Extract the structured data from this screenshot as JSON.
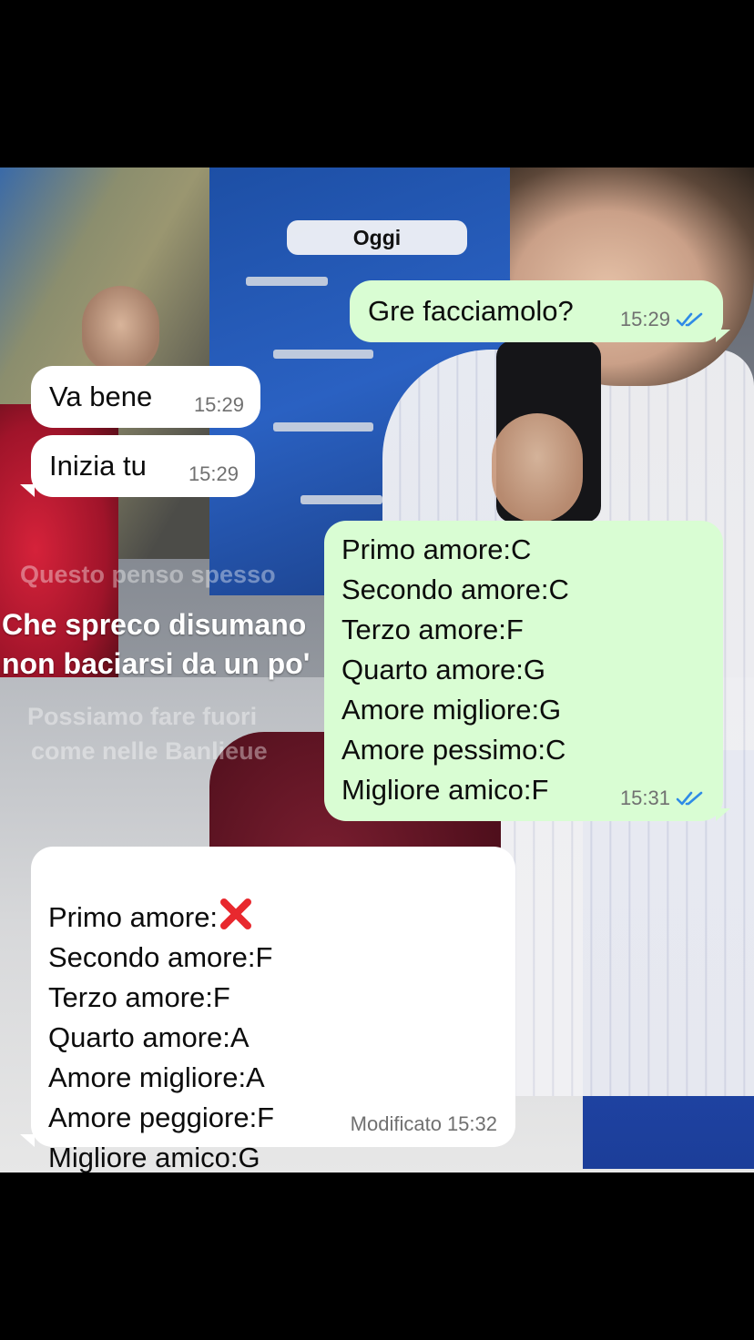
{
  "chat": {
    "date_label": "Oggi",
    "messages": [
      {
        "dir": "out",
        "text": "Gre facciamolo?",
        "time": "15:29",
        "status": "read"
      },
      {
        "dir": "in",
        "text": "Va bene",
        "time": "15:29"
      },
      {
        "dir": "in",
        "text": "Inizia tu",
        "time": "15:29"
      },
      {
        "dir": "out",
        "lines": [
          "Primo amore:C",
          "Secondo amore:C",
          "Terzo amore:F",
          "Quarto amore:G",
          "Amore migliore:G",
          "Amore pessimo:C",
          "Migliore amico:F"
        ],
        "time": "15:31",
        "status": "read"
      },
      {
        "dir": "in",
        "first_line_label": "Primo amore:",
        "first_line_emoji": "cross-mark-icon",
        "lines": [
          "Secondo amore:F",
          "Terzo amore:F",
          "Quarto amore:A",
          "Amore migliore:A",
          "Amore peggiore:F",
          "Migliore amico:G"
        ],
        "edited_label": "Modificato",
        "time": "15:32"
      }
    ]
  },
  "background_overlay": {
    "line1": "Questo penso spesso",
    "line2": "Che spreco disumano",
    "line3": "non baciarsi da un po'",
    "line4": "Possiamo fare fuori",
    "line5": "come nelle Banlieue"
  },
  "colors": {
    "outgoing_bubble": "#d9fdd3",
    "incoming_bubble": "#ffffff",
    "read_ticks": "#2f8be6",
    "cross_mark": "#e8282e"
  }
}
